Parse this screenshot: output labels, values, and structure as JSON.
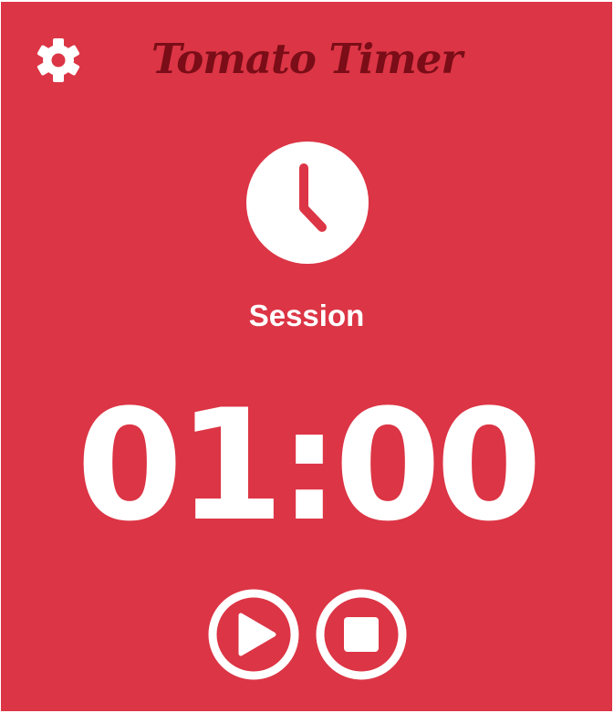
{
  "app": {
    "title": "Tomato Timer",
    "mode_label": "Session",
    "time_display": "01:00"
  },
  "icons": {
    "settings": "gear-icon",
    "mode": "clock-icon",
    "play": "play-icon",
    "stop": "stop-icon"
  },
  "colors": {
    "background": "#dc3545",
    "title": "#7a0d17",
    "foreground": "#ffffff"
  }
}
